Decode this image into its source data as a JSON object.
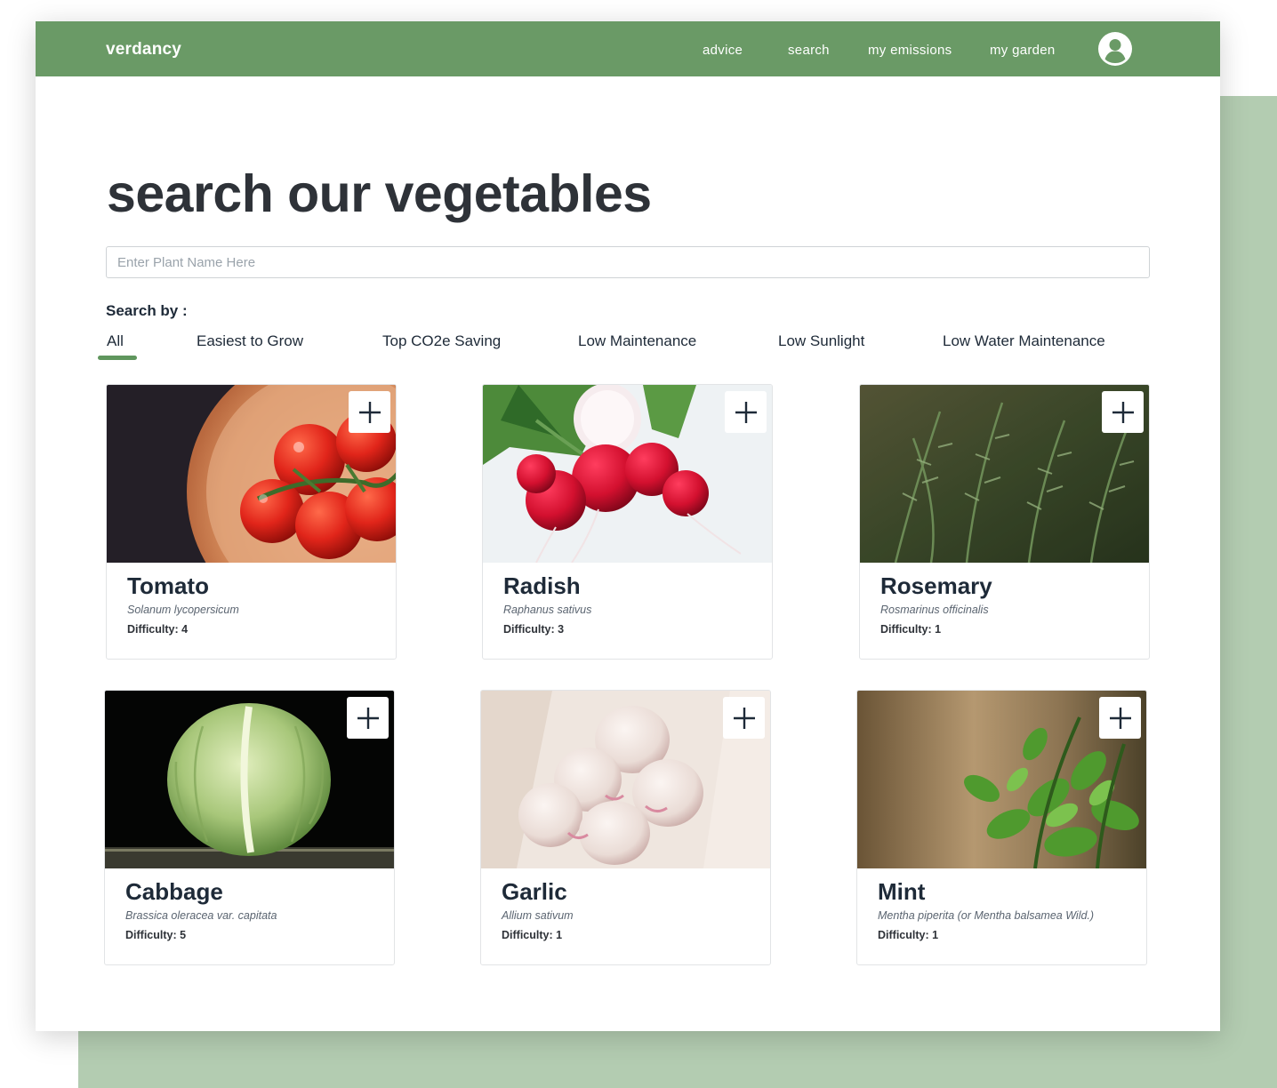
{
  "app": {
    "brand": "verdancy"
  },
  "nav": {
    "links": [
      {
        "label": "advice"
      },
      {
        "label": "search"
      },
      {
        "label": "my emissions"
      },
      {
        "label": "my garden"
      }
    ],
    "avatar_icon": "user-circle-icon"
  },
  "page": {
    "title": "search our vegetables",
    "search_placeholder": "Enter Plant Name Here",
    "search_value": ""
  },
  "filters": {
    "label": "Search by :",
    "active": "All",
    "tabs": [
      {
        "label": "All"
      },
      {
        "label": "Easiest to Grow"
      },
      {
        "label": "Top CO2e Saving"
      },
      {
        "label": "Low Maintenance"
      },
      {
        "label": "Low Sunlight"
      },
      {
        "label": "Low Water Maintenance"
      }
    ]
  },
  "plants": [
    {
      "name": "Tomato",
      "scientific": "Solanum lycopersicum",
      "difficulty": "Difficulty: 4",
      "image": "tomato-photo"
    },
    {
      "name": "Radish",
      "scientific": "Raphanus sativus",
      "difficulty": "Difficulty: 3",
      "image": "radish-photo"
    },
    {
      "name": "Rosemary",
      "scientific": "Rosmarinus officinalis",
      "difficulty": "Difficulty: 1",
      "image": "rosemary-photo"
    },
    {
      "name": "Cabbage",
      "scientific": "Brassica oleracea var. capitata",
      "difficulty": "Difficulty: 5",
      "image": "cabbage-photo"
    },
    {
      "name": "Garlic",
      "scientific": "Allium sativum",
      "difficulty": "Difficulty: 1",
      "image": "garlic-photo"
    },
    {
      "name": "Mint",
      "scientific": "Mentha piperita (or Mentha balsamea Wild.)",
      "difficulty": "Difficulty: 1",
      "image": "mint-photo"
    }
  ],
  "colors": {
    "brand_green": "#6a9a66",
    "backdrop_green": "#b3ccb1",
    "active_tab": "#5f965d",
    "heading_text": "#2e3238"
  }
}
